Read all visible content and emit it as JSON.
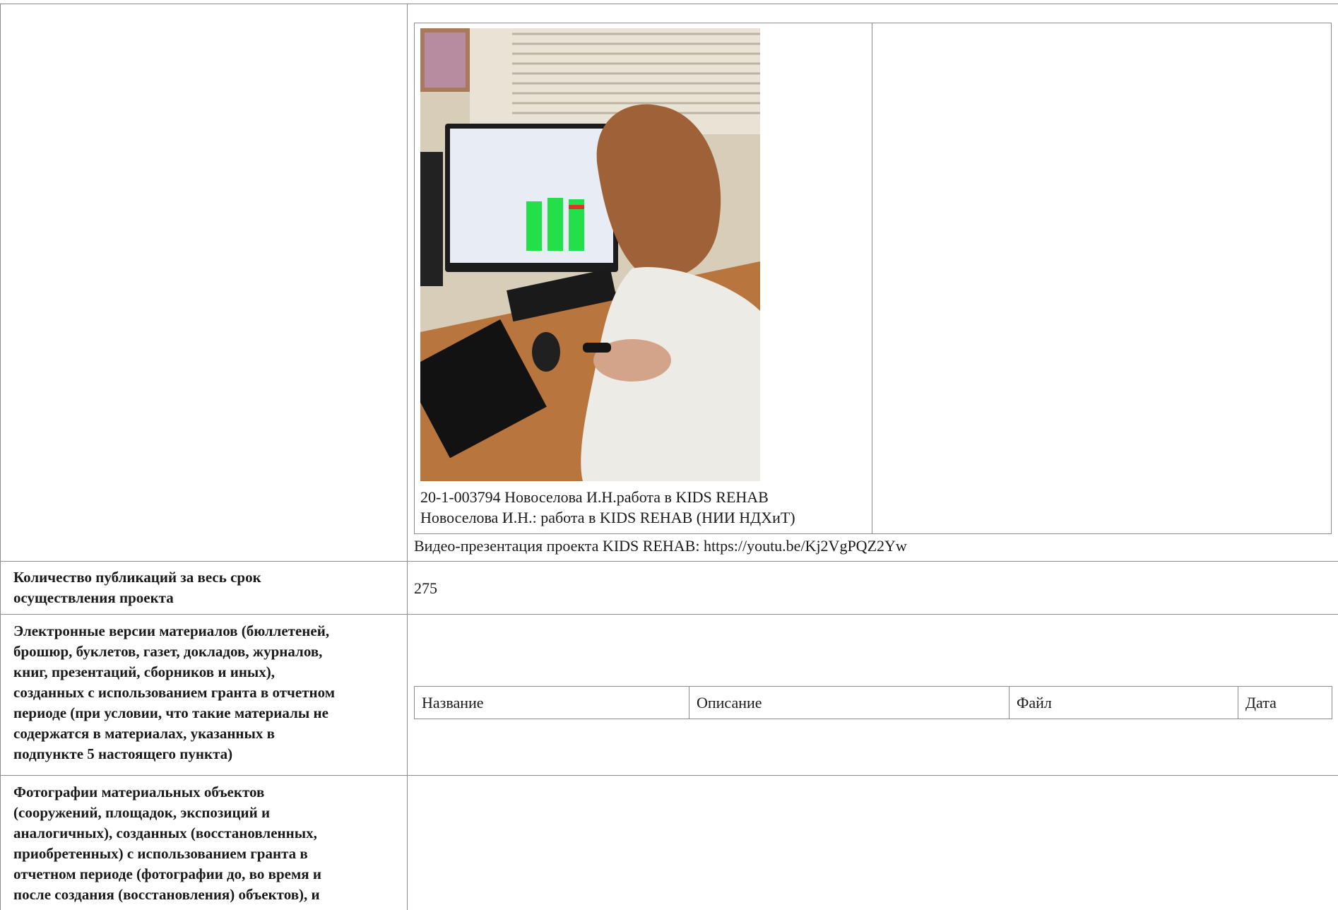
{
  "gallery": {
    "photo_alt": "Photo: woman at a workstation",
    "photo_caption_1": "20-1-003794 Новоселова И.Н.работа в KIDS REHAB",
    "photo_caption_2": "Новоселова И.Н.: работа в KIDS REHAB (НИИ НДХиТ)",
    "video_line": "Видео-презентация проекта KIDS REHAB: https://youtu.be/Kj2VgPQZ2Yw"
  },
  "publications": {
    "label_line1": "Количество публикаций за весь срок",
    "label_line2": "осуществления проекта",
    "value": "275"
  },
  "electronic_materials": {
    "label_lines": [
      "Электронные версии материалов (бюллетеней,",
      "брошюр, буклетов, газет, докладов, журналов,",
      "книг, презентаций, сборников и иных),",
      "созданных с использованием гранта в отчетном",
      "периоде (при условии, что такие материалы не",
      "содержатся в материалах, указанных в",
      "подпункте 5 настоящего пункта)"
    ],
    "table_headers": [
      "Название",
      "Описание",
      "Файл",
      "Дата"
    ]
  },
  "photos_section": {
    "label_lines": [
      "Фотографии материальных объектов",
      "(сооружений, площадок, экспозиций и",
      "аналогичных), созданных (восстановленных,",
      "приобретенных) с использованием гранта в",
      "отчетном периоде (фотографии до, во время и",
      "после создания (восстановления) объектов), и"
    ]
  }
}
